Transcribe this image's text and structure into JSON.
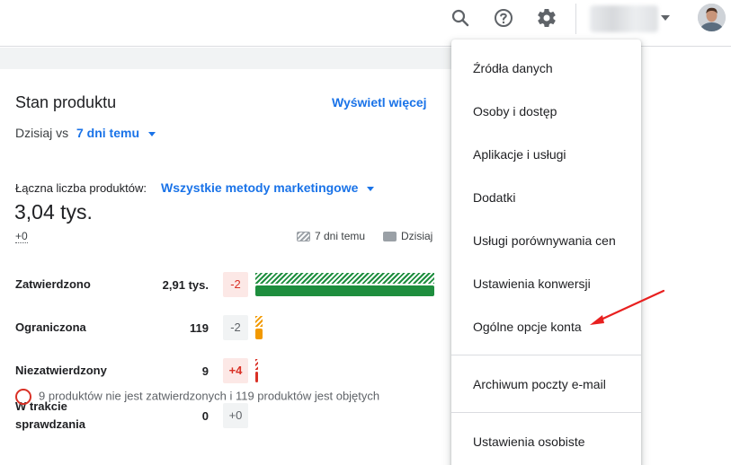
{
  "header": {
    "icons": [
      "search-icon",
      "help-icon",
      "gear-icon",
      "chevron-down-icon",
      "avatar"
    ]
  },
  "card": {
    "title": "Stan produktu",
    "see_more": "Wyświetl więcej",
    "compare_label": "Dzisiaj vs",
    "compare_value": "7 dni temu",
    "total_label": "Łączna liczba produktów:",
    "total_filter": "Wszystkie metody marketingowe",
    "total_value": "3,04 tys.",
    "total_delta": "+0",
    "legend": {
      "past": "7 dni temu",
      "today": "Dzisiaj"
    },
    "rows": [
      {
        "label": "Zatwierdzono",
        "count": "2,91 tys.",
        "delta": "-2",
        "past_fraction": 1.0,
        "today_fraction": 1.0,
        "color": "#1e8e3e"
      },
      {
        "label": "Ograniczona",
        "count": "119",
        "delta": "-2",
        "past_fraction": 0.04,
        "today_fraction": 0.04,
        "color": "#f29900"
      },
      {
        "label": "Niezatwierdzony",
        "count": "9",
        "delta": "+4",
        "past_fraction": 0.01,
        "today_fraction": 0.01,
        "color": "#d93025"
      },
      {
        "label": "W trakcie sprawdzania",
        "count": "0",
        "delta": "+0",
        "past_fraction": 0.0,
        "today_fraction": 0.0,
        "color": "#9aa0a6"
      }
    ],
    "warning_text": "9 produktów nie jest zatwierdzonych i 119 produktów jest objętych"
  },
  "menu": {
    "items": [
      "Źródła danych",
      "Osoby i dostęp",
      "Aplikacje i usługi",
      "Dodatki",
      "Usługi porównywania cen",
      "Ustawienia konwersji",
      "Ogólne opcje konta",
      "Archiwum poczty e-mail",
      "Ustawienia osobiste"
    ]
  },
  "colors": {
    "accent": "#1a73e8",
    "approved": "#1e8e3e",
    "limited": "#f29900",
    "disapproved": "#d93025",
    "annotation_arrow": "#e8201f"
  }
}
